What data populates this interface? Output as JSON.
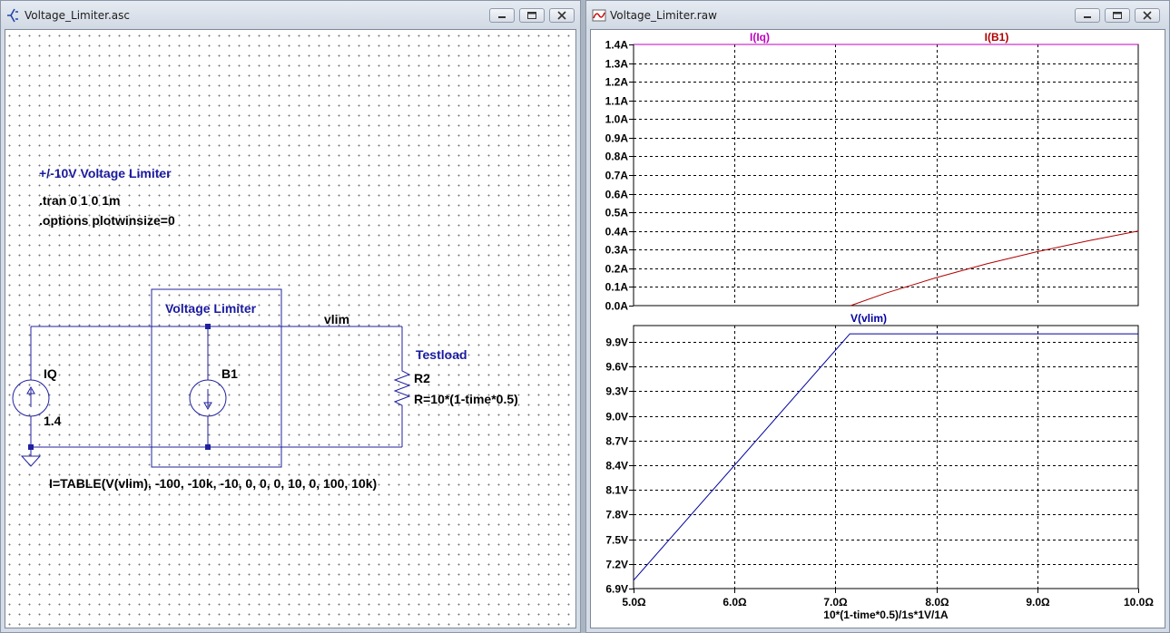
{
  "schematic": {
    "title": "Voltage_Limiter.asc",
    "comment": "+/-10V Voltage Limiter",
    "directives": [
      ".tran 0 1 0 1m",
      ".options plotwinsize=0"
    ],
    "block_label": "Voltage Limiter",
    "net_label": "vlim",
    "source": {
      "name": "IQ",
      "value": "1.4"
    },
    "bsource": {
      "name": "B1",
      "expr": "I=TABLE(V(vlim), -100, -10k, -10, 0, 0, 0, 10, 0, 100, 10k)"
    },
    "load": {
      "label": "Testload",
      "name": "R2",
      "value": "R=10*(1-time*0.5)"
    }
  },
  "plot_window": {
    "title": "Voltage_Limiter.raw"
  },
  "chart_data": [
    {
      "type": "line",
      "panel": "top",
      "series": [
        {
          "name": "I(Iq)",
          "color": "#c000c0",
          "x": [
            5.0,
            10.0
          ],
          "y": [
            1.4,
            1.4
          ]
        },
        {
          "name": "I(B1)",
          "color": "#b00000",
          "x": [
            7.15,
            7.5,
            8.0,
            8.5,
            9.0,
            9.5,
            10.0
          ],
          "y": [
            0.0,
            0.067,
            0.15,
            0.224,
            0.289,
            0.347,
            0.4
          ]
        }
      ],
      "y_ticks": [
        "0.0A",
        "0.1A",
        "0.2A",
        "0.3A",
        "0.4A",
        "0.5A",
        "0.6A",
        "0.7A",
        "0.8A",
        "0.9A",
        "1.0A",
        "1.1A",
        "1.2A",
        "1.3A",
        "1.4A"
      ],
      "ylim": [
        0.0,
        1.4
      ],
      "xlim": [
        5.0,
        10.0
      ],
      "grid": true
    },
    {
      "type": "line",
      "panel": "bottom",
      "series": [
        {
          "name": "V(vlim)",
          "color": "#0000a0",
          "x": [
            5.0,
            7.143,
            10.0
          ],
          "y": [
            7.0,
            10.0,
            10.0
          ]
        }
      ],
      "y_ticks": [
        "6.9V",
        "7.2V",
        "7.5V",
        "7.8V",
        "8.1V",
        "8.4V",
        "8.7V",
        "9.0V",
        "9.3V",
        "9.6V",
        "9.9V"
      ],
      "ylim": [
        6.9,
        10.1
      ],
      "x_ticks": [
        "5.0Ω",
        "6.0Ω",
        "7.0Ω",
        "8.0Ω",
        "9.0Ω",
        "10.0Ω"
      ],
      "xlim": [
        5.0,
        10.0
      ],
      "xlabel": "10*(1-time*0.5)/1s*1V/1A",
      "grid": true
    }
  ]
}
